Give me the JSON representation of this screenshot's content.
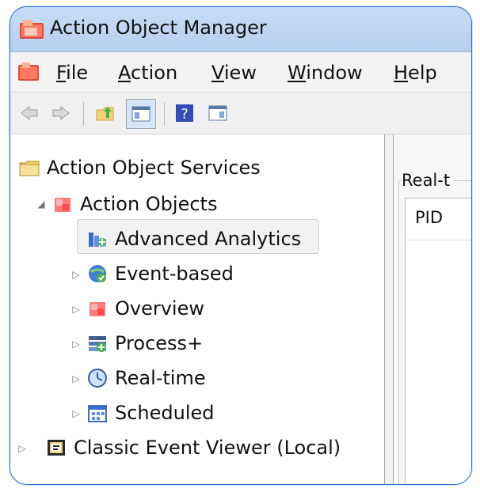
{
  "window": {
    "title": "Action Object Manager"
  },
  "menu": [
    {
      "pre": "",
      "ul": "F",
      "post": "ile"
    },
    {
      "pre": "",
      "ul": "A",
      "post": "ction"
    },
    {
      "pre": "",
      "ul": "V",
      "post": "iew"
    },
    {
      "pre": "",
      "ul": "W",
      "post": "indow"
    },
    {
      "pre": "",
      "ul": "H",
      "post": "elp"
    }
  ],
  "toolbar": {
    "buttons": [
      "back-arrow-icon",
      "forward-arrow-icon",
      "up-folder-icon",
      "show-hide-console-tree-icon",
      "help-icon",
      "show-hide-action-pane-icon"
    ]
  },
  "tree": {
    "root": "Action Object Services",
    "action_objects": "Action Objects",
    "children": [
      "Advanced Analytics",
      "Event-based",
      "Overview",
      "Process+",
      "Real-time",
      "Scheduled"
    ],
    "classic": "Classic Event Viewer (Local)"
  },
  "right_pane": {
    "group_title": "Real-t",
    "column_pid": "PID"
  },
  "colors": {
    "accent": "#1e6fd9",
    "selection": "#f2f2f2"
  }
}
